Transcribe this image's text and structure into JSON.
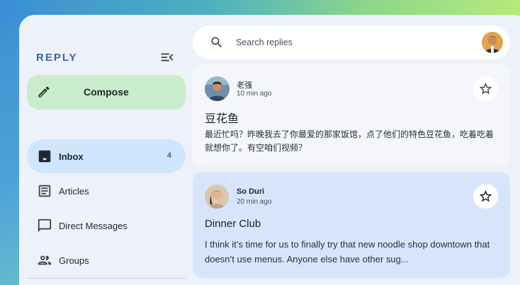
{
  "app": {
    "brand": "REPLY"
  },
  "compose": {
    "label": "Compose"
  },
  "nav": {
    "items": [
      {
        "label": "Inbox",
        "count": "4",
        "icon": "inbox-icon",
        "active": true
      },
      {
        "label": "Articles",
        "icon": "article-icon"
      },
      {
        "label": "Direct Messages",
        "icon": "chat-icon"
      },
      {
        "label": "Groups",
        "icon": "groups-icon"
      }
    ]
  },
  "search": {
    "placeholder": "Search replies"
  },
  "emails": [
    {
      "sender": "老强",
      "time": "10 min ago",
      "subject": "豆花鱼",
      "preview": "最近忙吗？昨晚我去了你最爱的那家饭馆，点了他们的特色豆花鱼，吃着吃着就想你了。有空咱们视频？"
    },
    {
      "sender": "So Duri",
      "time": "20 min ago",
      "subject": "Dinner Club",
      "preview": "I think it’s time for us to finally try that new noodle shop downtown that doesn’t use menus. Anyone else have other sug..."
    }
  ],
  "colors": {
    "brand": "#3a61a8",
    "compose_bg": "#c9eccc",
    "active_nav_bg": "#cfe6fc",
    "selected_card_bg": "#d6e5fb",
    "surface": "#edf1f9"
  }
}
